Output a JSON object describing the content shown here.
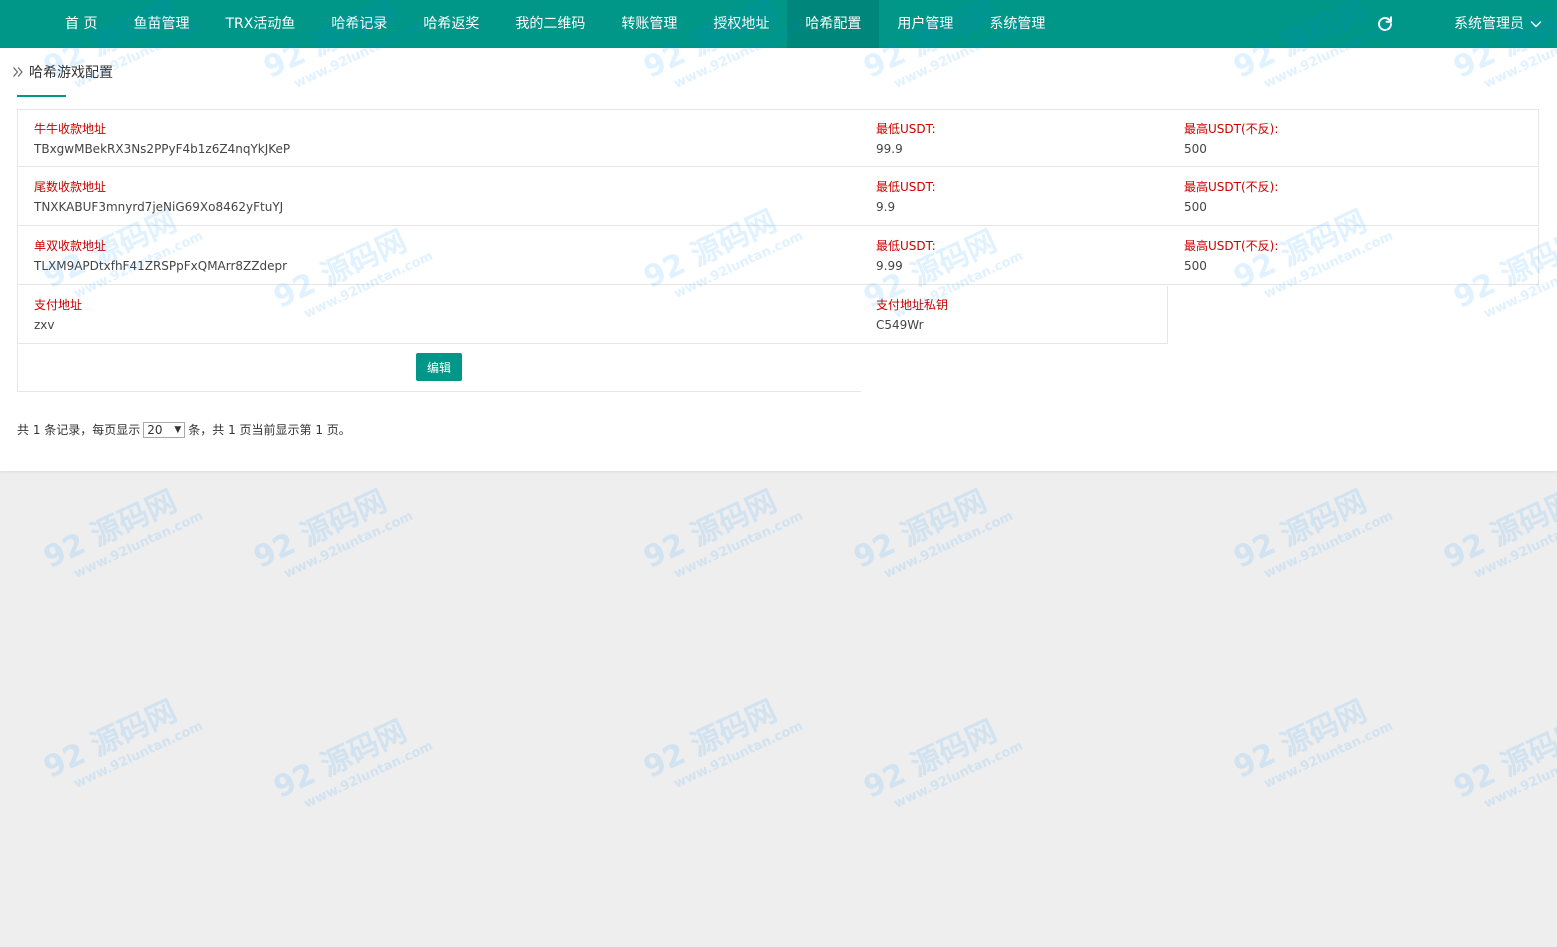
{
  "nav": {
    "items": [
      {
        "label": "首 页",
        "name": "nav-home"
      },
      {
        "label": "鱼苗管理",
        "name": "nav-fish-management"
      },
      {
        "label": "TRX活动鱼",
        "name": "nav-trx-fish"
      },
      {
        "label": "哈希记录",
        "name": "nav-hash-records"
      },
      {
        "label": "哈希返奖",
        "name": "nav-hash-rewards"
      },
      {
        "label": "我的二维码",
        "name": "nav-my-qrcode"
      },
      {
        "label": "转账管理",
        "name": "nav-transfer-management"
      },
      {
        "label": "授权地址",
        "name": "nav-authorized-address"
      },
      {
        "label": "哈希配置",
        "name": "nav-hash-config",
        "active": true
      },
      {
        "label": "用户管理",
        "name": "nav-user-management"
      },
      {
        "label": "系统管理",
        "name": "nav-system-management"
      }
    ],
    "admin_label": "系统管理员",
    "refresh_icon": "refresh-icon",
    "dropdown_icon": "chevron-down-icon"
  },
  "breadcrumb": {
    "title": "哈希游戏配置"
  },
  "config": {
    "rows": [
      {
        "address_label": "牛牛收款地址",
        "address_value": "TBxgwMBekRX3Ns2PPyF4b1z6Z4nqYkJKeP",
        "min_label": "最低USDT:",
        "min_value": "99.9",
        "max_label": "最高USDT(不反):",
        "max_value": "500"
      },
      {
        "address_label": "尾数收款地址",
        "address_value": "TNXKABUF3mnyrd7jeNiG69Xo8462yFtuYJ",
        "min_label": "最低USDT:",
        "min_value": "9.9",
        "max_label": "最高USDT(不反):",
        "max_value": "500"
      },
      {
        "address_label": "单双收款地址",
        "address_value": "TLXM9APDtxfhF41ZRSPpFxQMArr8ZZdepr",
        "min_label": "最低USDT:",
        "min_value": "9.99",
        "max_label": "最高USDT(不反):",
        "max_value": "500"
      }
    ],
    "pay": {
      "address_label": "支付地址",
      "address_value": "zxv",
      "key_label": "支付地址私钥",
      "key_value": "C549Wr"
    },
    "edit_label": "编辑"
  },
  "pager": {
    "prefix": "共 1 条记录，每页显示",
    "page_size": "20",
    "suffix": "条，共 1 页当前显示第 1 页。"
  },
  "watermark": {
    "big": "92 源码网",
    "small": "www.92luntan.com"
  },
  "colors": {
    "brand": "#009688",
    "label_red": "#cc0000",
    "page_bg": "#eeeeee"
  }
}
